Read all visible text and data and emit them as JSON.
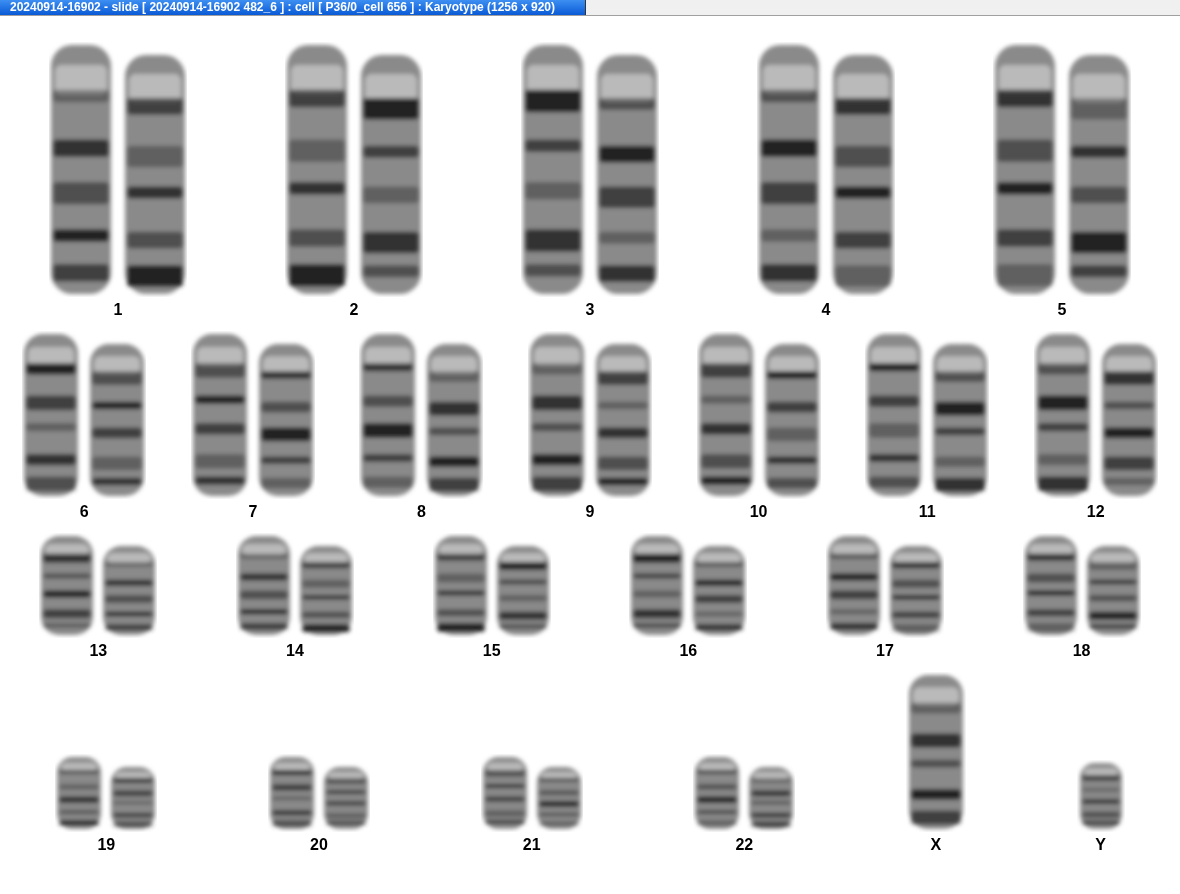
{
  "window": {
    "title": "20240914-16902 - slide [ 20240914-16902 482_6 ] : cell [ P36/0_cell 656 ] : Karyotype  (1256 x 920)"
  },
  "karyotype_rows": [
    [
      {
        "label": "1",
        "kind": "pair"
      },
      {
        "label": "2",
        "kind": "pair"
      },
      {
        "label": "3",
        "kind": "pair"
      },
      {
        "label": "4",
        "kind": "pair"
      },
      {
        "label": "5",
        "kind": "pair"
      }
    ],
    [
      {
        "label": "6",
        "kind": "pair"
      },
      {
        "label": "7",
        "kind": "pair"
      },
      {
        "label": "8",
        "kind": "pair"
      },
      {
        "label": "9",
        "kind": "pair"
      },
      {
        "label": "10",
        "kind": "pair"
      },
      {
        "label": "11",
        "kind": "pair"
      },
      {
        "label": "12",
        "kind": "pair"
      }
    ],
    [
      {
        "label": "13",
        "kind": "pair"
      },
      {
        "label": "14",
        "kind": "pair"
      },
      {
        "label": "15",
        "kind": "pair"
      },
      {
        "label": "16",
        "kind": "pair"
      },
      {
        "label": "17",
        "kind": "pair"
      },
      {
        "label": "18",
        "kind": "pair"
      }
    ],
    [
      {
        "label": "19",
        "kind": "pair"
      },
      {
        "label": "20",
        "kind": "pair"
      },
      {
        "label": "21",
        "kind": "pair"
      },
      {
        "label": "22",
        "kind": "pair"
      },
      {
        "label": "X",
        "kind": "single"
      },
      {
        "label": "Y",
        "kind": "single"
      }
    ]
  ]
}
